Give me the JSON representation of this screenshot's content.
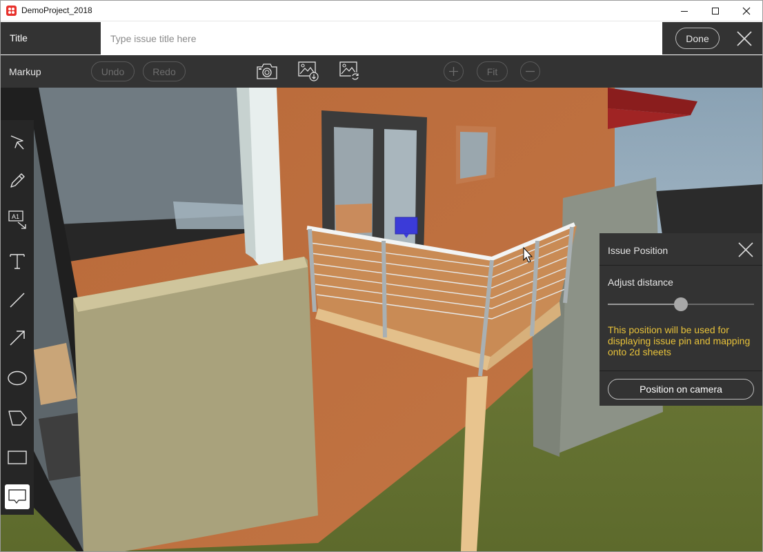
{
  "window": {
    "title": "DemoProject_2018",
    "controls": [
      "minimize",
      "maximize",
      "close"
    ]
  },
  "title_row": {
    "label": "Title",
    "input_placeholder": "Type issue title here",
    "input_value": "",
    "done_label": "Done"
  },
  "markup_row": {
    "label": "Markup",
    "undo_label": "Undo",
    "redo_label": "Redo",
    "fit_label": "Fit",
    "icons": [
      "camera-icon",
      "image-download-icon",
      "image-refresh-icon",
      "zoom-in-icon",
      "zoom-out-icon"
    ]
  },
  "tools": [
    {
      "name": "select-tool",
      "icon": "cursor-arrow"
    },
    {
      "name": "pencil-tool",
      "icon": "pencil"
    },
    {
      "name": "label-tool",
      "icon": "A1-label"
    },
    {
      "name": "text-tool",
      "icon": "text-T"
    },
    {
      "name": "line-tool",
      "icon": "line"
    },
    {
      "name": "arrow-tool",
      "icon": "arrow"
    },
    {
      "name": "ellipse-tool",
      "icon": "ellipse"
    },
    {
      "name": "polygon-tool",
      "icon": "pentagon"
    },
    {
      "name": "rectangle-tool",
      "icon": "rectangle"
    },
    {
      "name": "comment-tool",
      "icon": "speech-bubble",
      "active": true
    }
  ],
  "issue_panel": {
    "title": "Issue Position",
    "adjust_label": "Adjust distance",
    "distance_fraction": 0.5,
    "note": "This position will be used for displaying issue pin and mapping onto 2d sheets",
    "position_button": "Position on camera"
  },
  "colors": {
    "toolbar_bg": "#333333",
    "note_text": "#e8c23a",
    "issue_pin": "#3b3bd8",
    "app_logo": "#e8322d"
  }
}
